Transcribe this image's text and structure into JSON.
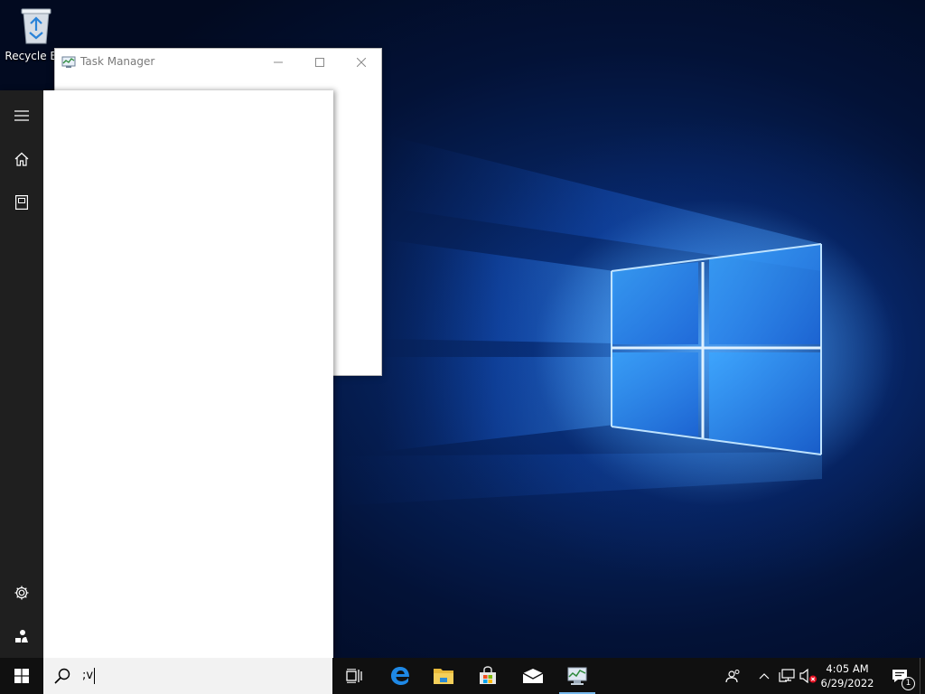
{
  "desktop": {
    "icons": [
      {
        "label": "Recycle Bin"
      }
    ]
  },
  "task_manager": {
    "title": "Task Manager",
    "controls": [
      "minimize",
      "maximize",
      "close"
    ]
  },
  "start_menu": {
    "rail_top": [
      {
        "icon": "hamburger-menu-icon"
      },
      {
        "icon": "home-icon"
      },
      {
        "icon": "documents-icon"
      }
    ],
    "rail_bottom": [
      {
        "icon": "gear-icon"
      },
      {
        "icon": "power-user-icon"
      }
    ]
  },
  "taskbar": {
    "search": {
      "value": ";v"
    },
    "pinned_apps": [
      {
        "icon": "task-view-icon"
      },
      {
        "icon": "edge-icon"
      },
      {
        "icon": "file-explorer-icon"
      },
      {
        "icon": "store-icon"
      },
      {
        "icon": "mail-icon"
      },
      {
        "icon": "task-manager-icon",
        "active": true
      }
    ],
    "tray": {
      "icons": [
        "people-icon",
        "chevron-up-icon",
        "network-icon",
        "volume-muted-icon"
      ],
      "clock": {
        "time": "4:05 AM",
        "date": "6/29/2022"
      },
      "notification_count": "1"
    }
  },
  "colors": {
    "taskbar_bg": "#101010",
    "start_rail_bg": "#1f1f1f",
    "search_bg": "#f2f2f2",
    "wallpaper_accent": "#2a7fff",
    "active_indicator": "#76b9ed"
  }
}
